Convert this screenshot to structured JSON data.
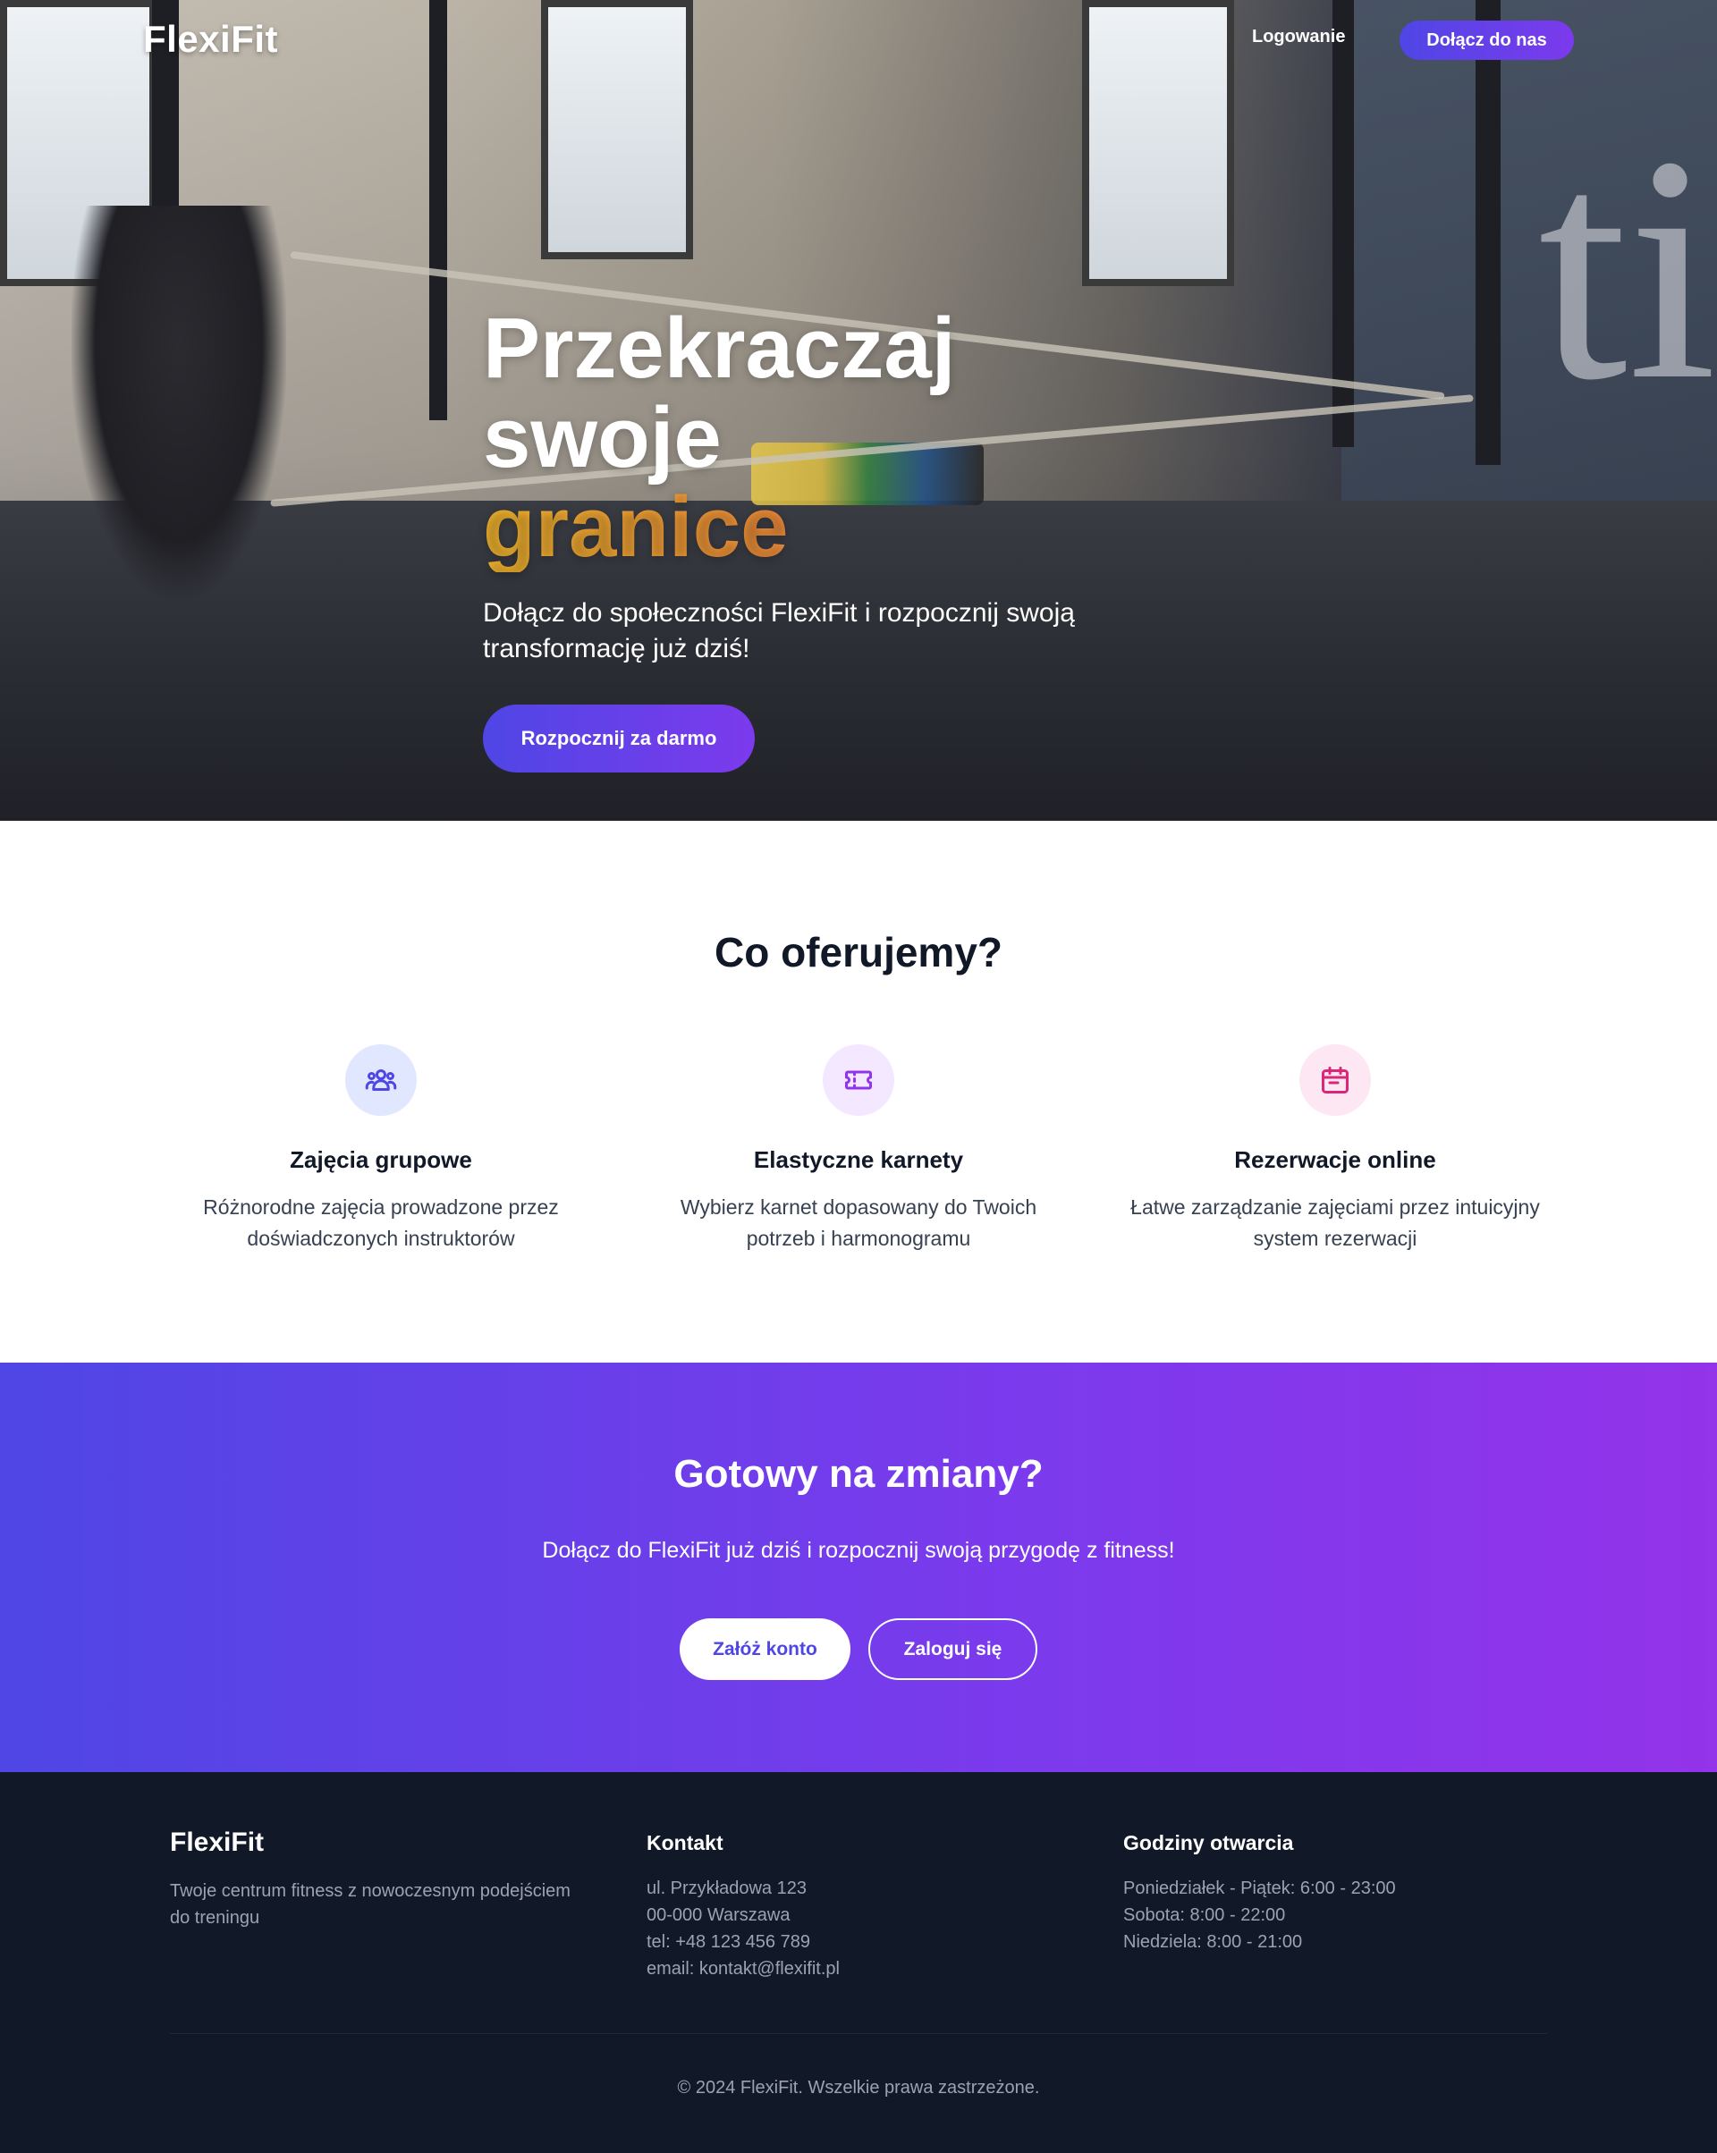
{
  "nav": {
    "logo": "FlexiFit",
    "login_label": "Logowanie",
    "join_label": "Dołącz do nas"
  },
  "hero": {
    "title_line1": "Przekraczaj swoje",
    "title_accent": "granice",
    "subtitle": "Dołącz do społeczności FlexiFit i rozpocznij swoją transformację już dziś!",
    "cta_label": "Rozpocznij za darmo",
    "background_image": "gym-battle-ropes-photo",
    "wall_letters": "ti"
  },
  "offer": {
    "title": "Co oferujemy?",
    "features": [
      {
        "icon": "users-group-icon",
        "title": "Zajęcia grupowe",
        "desc": "Różnorodne zajęcia prowadzone przez doświadczonych instruktorów",
        "color": "#4f46e5"
      },
      {
        "icon": "ticket-icon",
        "title": "Elastyczne karnety",
        "desc": "Wybierz karnet dopasowany do Twoich potrzeb i harmonogramu",
        "color": "#9333ea"
      },
      {
        "icon": "calendar-icon",
        "title": "Rezerwacje online",
        "desc": "Łatwe zarządzanie zajęciami przez intuicyjny system rezerwacji",
        "color": "#db2777"
      }
    ]
  },
  "cta": {
    "title": "Gotowy na zmiany?",
    "subtitle": "Dołącz do FlexiFit już dziś i rozpocznij swoją przygodę z fitness!",
    "create_label": "Załóż konto",
    "login_label": "Zaloguj się"
  },
  "footer": {
    "brand": "FlexiFit",
    "tagline": "Twoje centrum fitness z nowoczesnym podejściem do treningu",
    "contact": {
      "heading": "Kontakt",
      "lines": [
        "ul. Przykładowa 123",
        "00-000 Warszawa",
        "tel: +48 123 456 789",
        "email: kontakt@flexifit.pl"
      ]
    },
    "hours": {
      "heading": "Godziny otwarcia",
      "lines": [
        "Poniedziałek - Piątek: 6:00 - 23:00",
        "Sobota: 8:00 - 22:00",
        "Niedziela: 8:00 - 21:00"
      ]
    },
    "copyright": "© 2024 FlexiFit. Wszelkie prawa zastrzeżone."
  },
  "colors": {
    "primary": "#4f46e5",
    "secondary": "#7c3aed",
    "accent_gradient": [
      "#f5b82e",
      "#e94f8a"
    ],
    "footer_bg": "#111827"
  }
}
